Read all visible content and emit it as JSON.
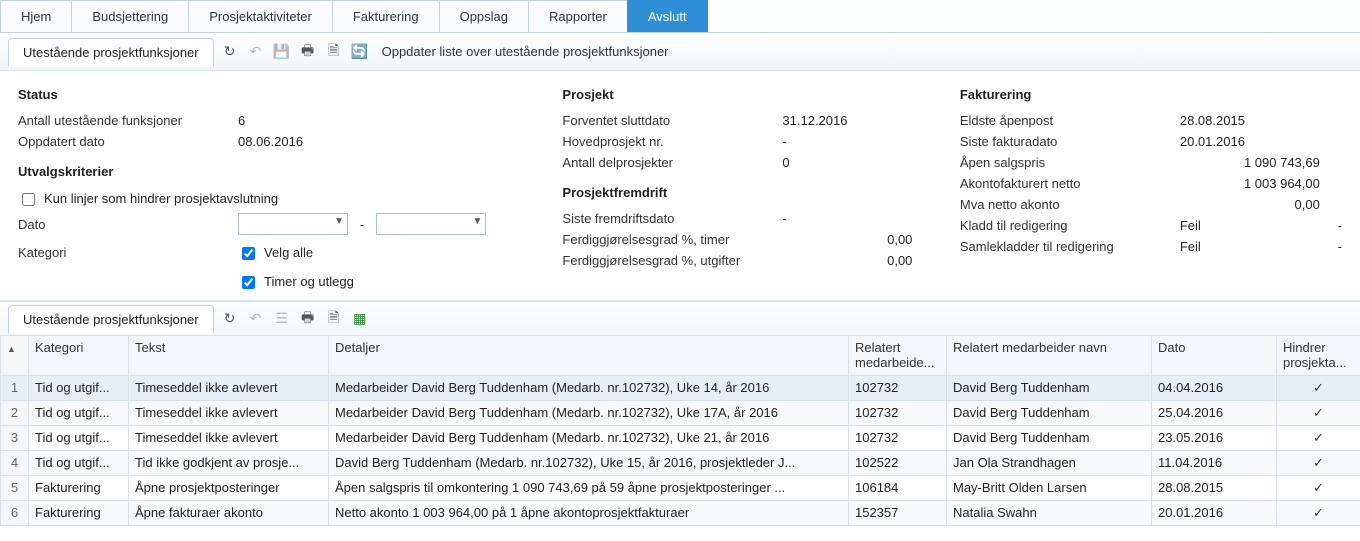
{
  "topTabs": {
    "items": [
      "Hjem",
      "Budsjettering",
      "Prosjektaktiviteter",
      "Fakturering",
      "Oppslag",
      "Rapporter",
      "Avslutt"
    ],
    "active": 6
  },
  "toolbar1": {
    "subtab": "Utestående prosjektfunksjoner",
    "refreshText": "Oppdater liste over utestående prosjektfunksjoner"
  },
  "status": {
    "title": "Status",
    "count_label": "Antall utestående funksjoner",
    "count_value": "6",
    "updated_label": "Oppdatert dato",
    "updated_value": "08.06.2016"
  },
  "criteria": {
    "title": "Utvalgskriterier",
    "only_blocking_label": "Kun linjer som hindrer prosjektavslutning",
    "only_blocking_checked": false,
    "date_label": "Dato",
    "date_from": "",
    "date_to": "",
    "category_label": "Kategori",
    "select_all_label": "Velg alle",
    "select_all_checked": true,
    "timer_label": "Timer og utlegg",
    "timer_checked": true
  },
  "project": {
    "title": "Prosjekt",
    "expected_end_label": "Forventet sluttdato",
    "expected_end_value": "31.12.2016",
    "main_project_label": "Hovedprosjekt nr.",
    "main_project_value": "-",
    "subprojects_label": "Antall delprosjekter",
    "subprojects_value": "0"
  },
  "progress": {
    "title": "Prosjektfremdrift",
    "last_date_label": "Siste fremdriftsdato",
    "last_date_value": "-",
    "hours_pct_label": "Ferdiggjørelsesgrad %, timer",
    "hours_pct_value": "0,00",
    "exp_pct_label": "Ferdiggjørelsesgrad %, utgifter",
    "exp_pct_value": "0,00"
  },
  "invoicing": {
    "title": "Fakturering",
    "oldest_open_label": "Eldste åpenpost",
    "oldest_open_value": "28.08.2015",
    "last_inv_label": "Siste fakturadato",
    "last_inv_value": "20.01.2016",
    "open_sale_label": "Åpen salgspris",
    "open_sale_value": "1 090 743,69",
    "akonto_net_label": "Akontofakturert netto",
    "akonto_net_value": "1 003 964,00",
    "vat_net_label": "Mva netto akonto",
    "vat_net_value": "0,00",
    "draft_edit_label": "Kladd til redigering",
    "draft_edit_value": "Feil",
    "draft_edit_value2": "-",
    "batch_edit_label": "Samlekladder til redigering",
    "batch_edit_value": "Feil",
    "batch_edit_value2": "-"
  },
  "toolbar2": {
    "subtab": "Utestående prosjektfunksjoner"
  },
  "grid": {
    "headers": {
      "row": "",
      "kategori": "Kategori",
      "tekst": "Tekst",
      "detaljer": "Detaljer",
      "rel_med": "Relatert medarbeide...",
      "rel_med_navn": "Relatert medarbeider navn",
      "dato": "Dato",
      "hindrer": "Hindrer prosjekta..."
    },
    "rows": [
      {
        "n": "1",
        "kategori": "Tid og utgif...",
        "tekst": "Timeseddel ikke avlevert",
        "detaljer": "Medarbeider David Berg Tuddenham (Medarb. nr.102732), Uke 14, år 2016",
        "rel": "102732",
        "navn": "David Berg Tuddenham",
        "dato": "04.04.2016",
        "hindrer": "✓"
      },
      {
        "n": "2",
        "kategori": "Tid og utgif...",
        "tekst": "Timeseddel ikke avlevert",
        "detaljer": "Medarbeider David Berg Tuddenham (Medarb. nr.102732), Uke 17A, år 2016",
        "rel": "102732",
        "navn": "David Berg Tuddenham",
        "dato": "25.04.2016",
        "hindrer": "✓"
      },
      {
        "n": "3",
        "kategori": "Tid og utgif...",
        "tekst": "Timeseddel ikke avlevert",
        "detaljer": "Medarbeider David Berg Tuddenham (Medarb. nr.102732), Uke 21, år 2016",
        "rel": "102732",
        "navn": "David Berg Tuddenham",
        "dato": "23.05.2016",
        "hindrer": "✓"
      },
      {
        "n": "4",
        "kategori": "Tid og utgif...",
        "tekst": "Tid ikke godkjent av prosje...",
        "detaljer": "David Berg Tuddenham (Medarb. nr.102732), Uke 15, år 2016, prosjektleder J...",
        "rel": "102522",
        "navn": "Jan Ola Strandhagen",
        "dato": "11.04.2016",
        "hindrer": "✓"
      },
      {
        "n": "5",
        "kategori": "Fakturering",
        "tekst": "Åpne prosjektposteringer",
        "detaljer": "Åpen salgspris til omkontering 1 090 743,69 på 59 åpne prosjektposteringer ...",
        "rel": "106184",
        "navn": "May-Britt Olden Larsen",
        "dato": "28.08.2015",
        "hindrer": "✓"
      },
      {
        "n": "6",
        "kategori": "Fakturering",
        "tekst": "Åpne fakturaer akonto",
        "detaljer": "Netto akonto 1 003 964,00 på 1 åpne akontoprosjektfakturaer",
        "rel": "152357",
        "navn": "Natalia Swahn",
        "dato": "20.01.2016",
        "hindrer": "✓"
      }
    ]
  }
}
